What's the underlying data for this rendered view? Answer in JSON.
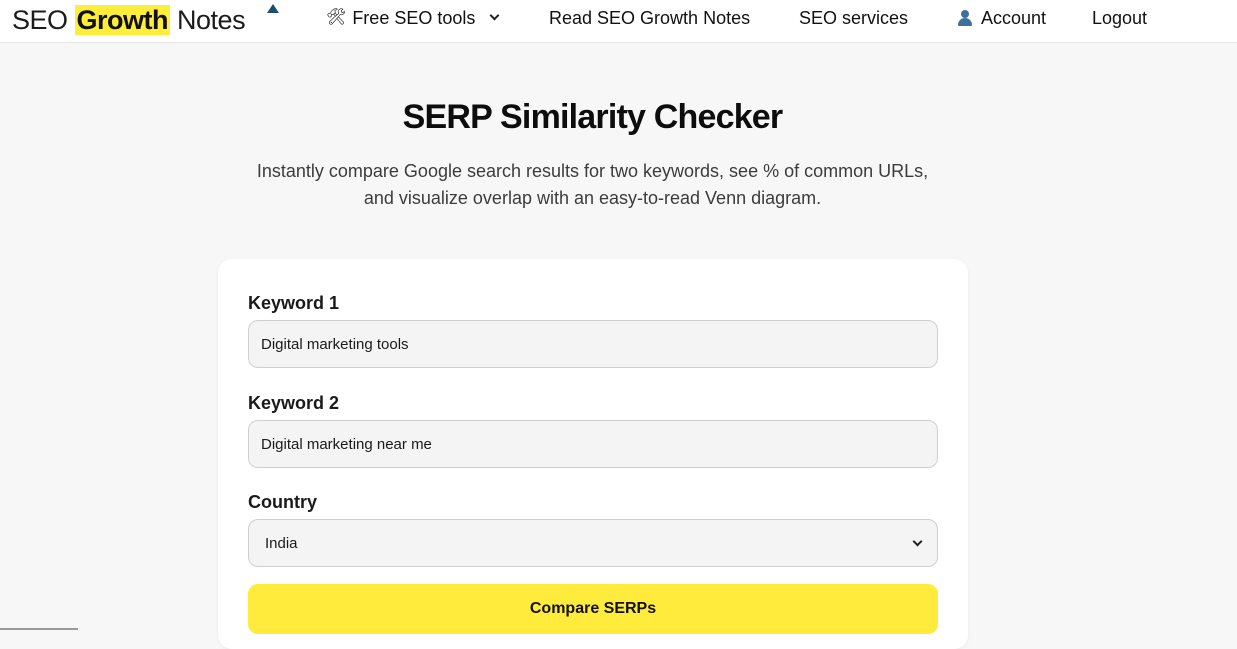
{
  "header": {
    "logo": {
      "part1": "SEO ",
      "part2": "Growth",
      "part3": " Notes"
    },
    "nav": [
      {
        "label": "Free SEO tools",
        "icon": "tools-icon",
        "has_dropdown": true
      },
      {
        "label": "Read SEO Growth Notes"
      },
      {
        "label": "SEO services"
      },
      {
        "label": "Account",
        "icon": "user-icon"
      },
      {
        "label": "Logout"
      }
    ]
  },
  "hero": {
    "title": "SERP Similarity Checker",
    "subtitle": "Instantly compare Google search results for two keywords, see % of common URLs, and visualize overlap with an easy-to-read Venn diagram."
  },
  "form": {
    "keyword1": {
      "label": "Keyword 1",
      "value": "Digital marketing tools"
    },
    "keyword2": {
      "label": "Keyword 2",
      "value": "Digital marketing near me"
    },
    "country": {
      "label": "Country",
      "value": "India"
    },
    "submit_label": "Compare SERPs"
  },
  "colors": {
    "accent": "#ffeb3b",
    "logo_highlight": "#ffed3b",
    "background": "#f7f7f7"
  }
}
